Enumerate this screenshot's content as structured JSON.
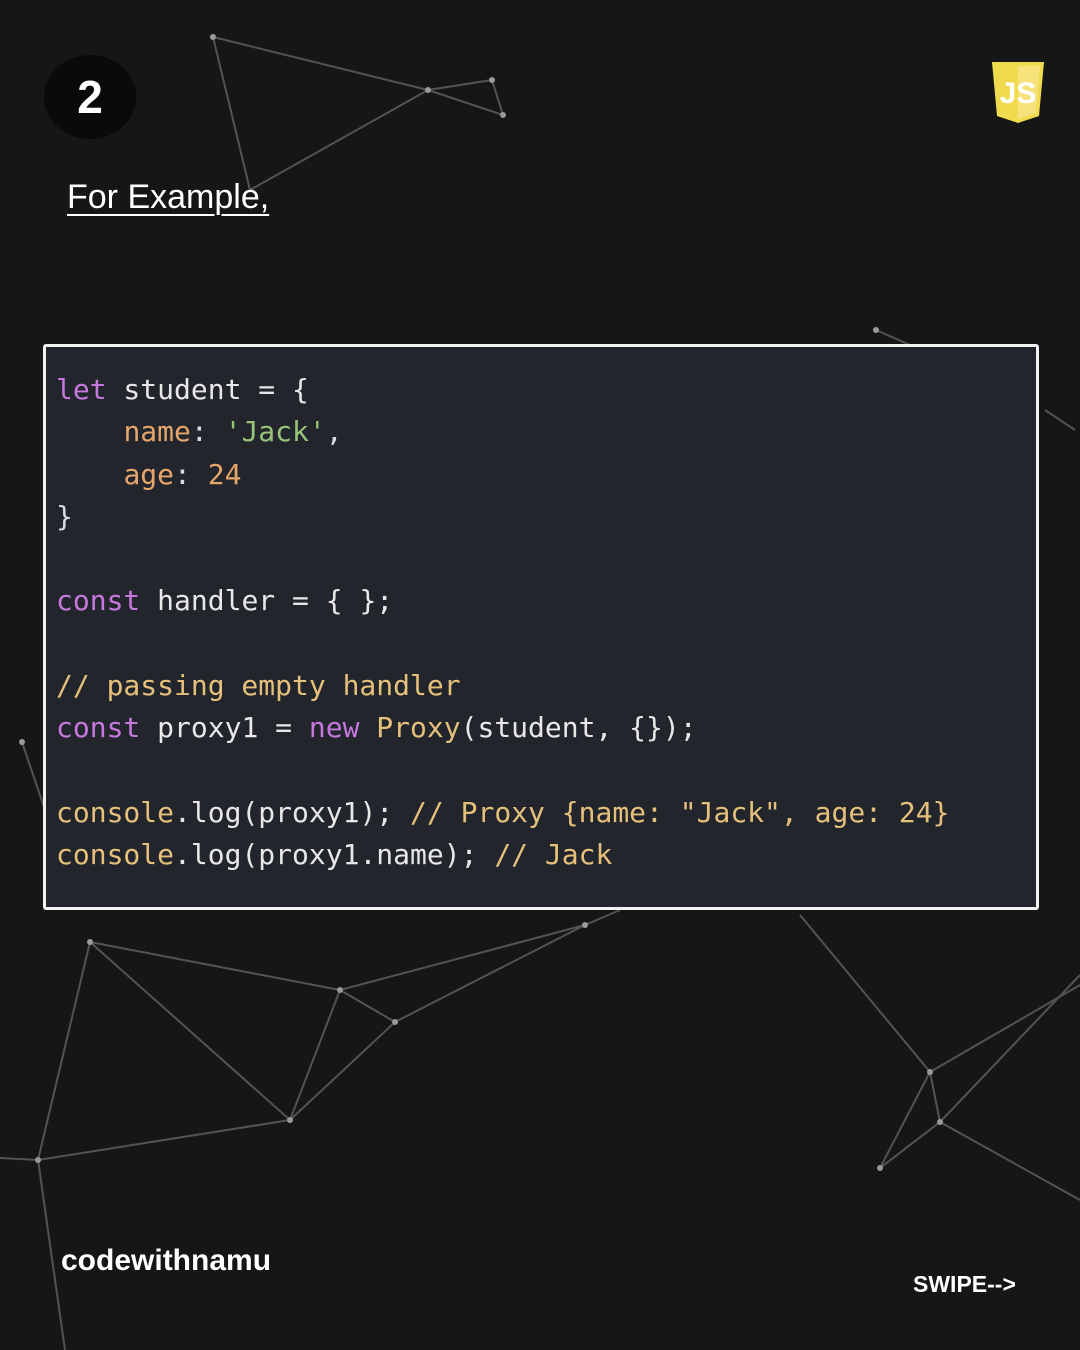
{
  "slide": {
    "number": "2"
  },
  "logo": {
    "text": "JS",
    "icon": "javascript-shield-icon",
    "color": "#f0db4f"
  },
  "heading": "For Example,",
  "code": {
    "line1": {
      "kw": "let",
      "rest": " student = {"
    },
    "line2": {
      "indent": "    ",
      "key": "name",
      "colon": ": ",
      "value": "'Jack'",
      "end": ","
    },
    "line3": {
      "indent": "    ",
      "key": "age",
      "colon": ": ",
      "value": "24"
    },
    "line4": "}",
    "line6": {
      "kw": "const",
      "rest": " handler = { };"
    },
    "line8": "// passing empty handler",
    "line9": {
      "kw": "const",
      "ident": " proxy1 = ",
      "kw2": "new",
      "cls": " Proxy",
      "rest": "(student, {});"
    },
    "line11": {
      "call": "console",
      "rest": ".log(proxy1); ",
      "comment": "// Proxy {name: \"Jack\", age: 24}"
    },
    "line12": {
      "call": "console",
      "rest": ".log(proxy1.name); ",
      "comment": "// Jack"
    }
  },
  "colors": {
    "background": "#161616",
    "code_background": "#22252c",
    "keyword": "#c678dd",
    "property": "#e5a56b",
    "string": "#98c379",
    "comment": "#e5c07b"
  },
  "footer": {
    "brand": "codewithnamu",
    "swipe": "SWIPE-->"
  }
}
